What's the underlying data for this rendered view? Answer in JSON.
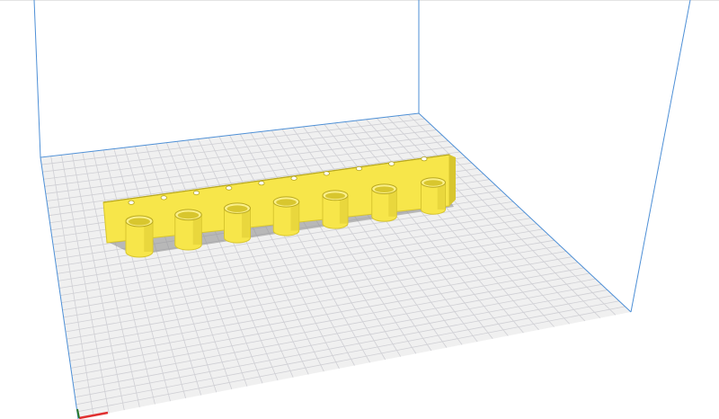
{
  "viewport": {
    "name": "3d-build-plate-view",
    "background_color": "#ffffff",
    "plate_color": "#f0f0f0",
    "grid_line_color": "#cfcfd4",
    "volume_edge_color": "#4d8fd6",
    "origin_x_axis_color": "#e03030",
    "origin_y_axis_color": "#2a7a2a"
  },
  "model": {
    "name": "tool-holder-rail",
    "body_color": "#f7e64a",
    "shade_color": "#d8c62e",
    "dark_color": "#b8a820",
    "shadow_color": "#8a8a8a",
    "cup_count": 7,
    "hole_count": 10
  }
}
